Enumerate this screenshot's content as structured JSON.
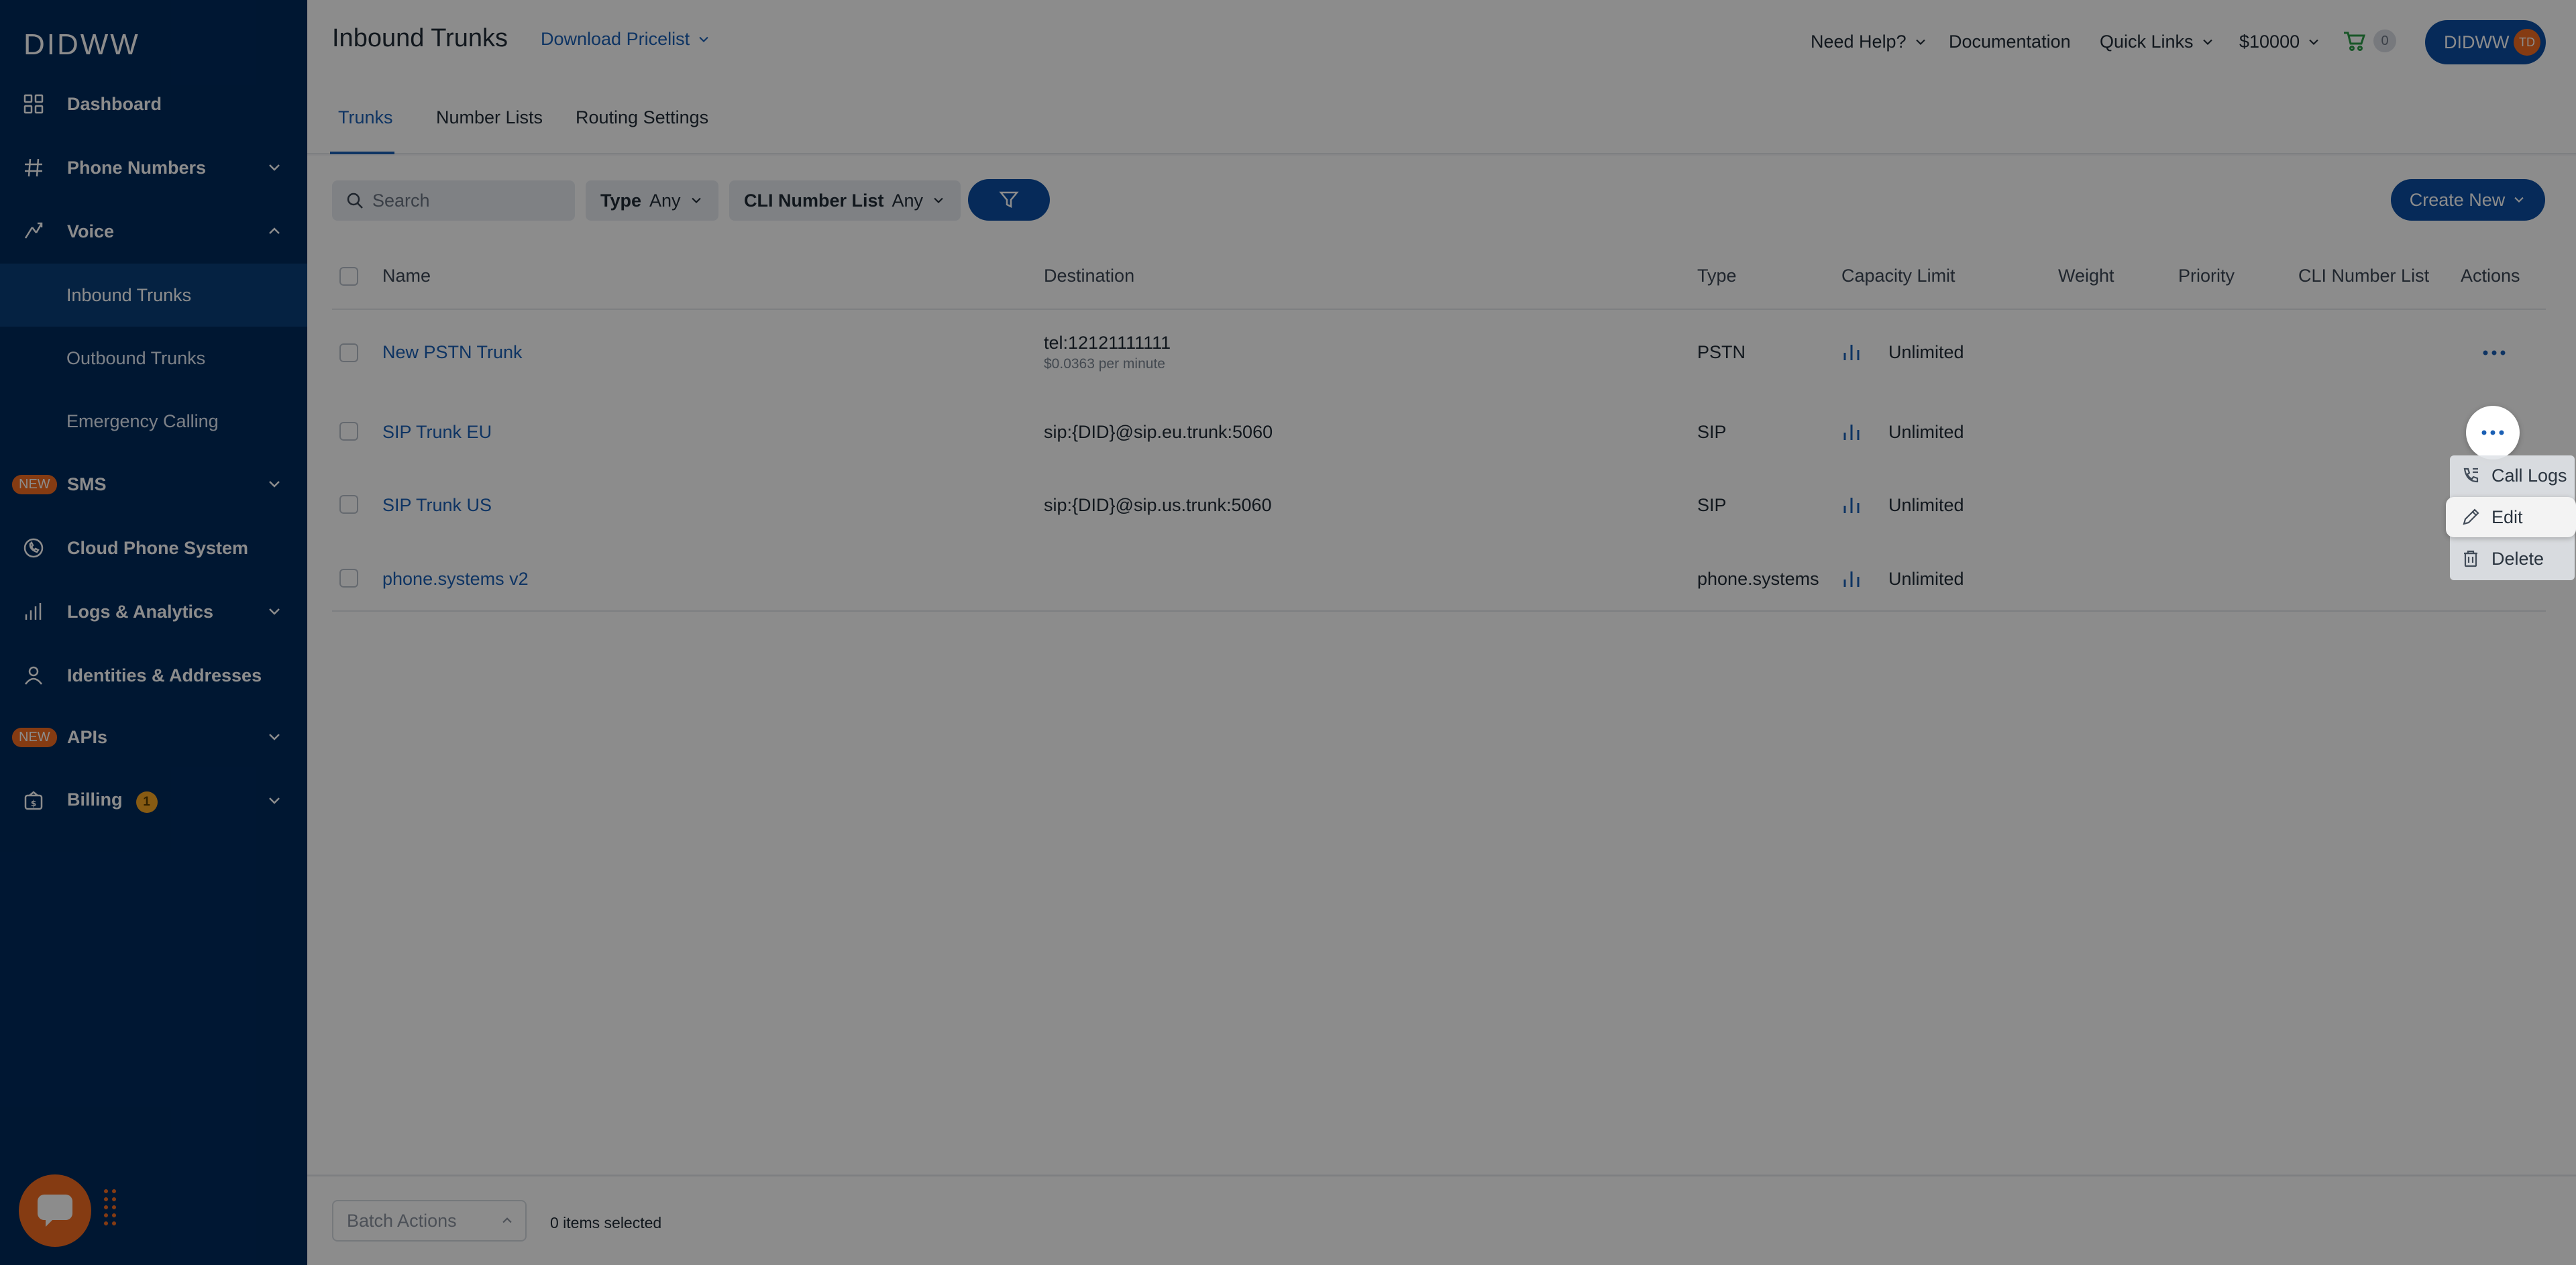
{
  "brand": {
    "logo_text": "DIDWW",
    "accent": "#0b4ea2",
    "sidebar_bg": "#002a5c",
    "orange": "#f36c21"
  },
  "sidebar": {
    "items": [
      {
        "label": "Dashboard",
        "icon": "grid-icon"
      },
      {
        "label": "Phone Numbers",
        "icon": "hash-icon"
      },
      {
        "label": "Voice",
        "icon": "voice-icon"
      },
      {
        "label": "SMS",
        "icon": "new-badge",
        "badge": "NEW"
      },
      {
        "label": "Cloud Phone System",
        "icon": "phone-icon"
      },
      {
        "label": "Logs & Analytics",
        "icon": "bar-chart-icon"
      },
      {
        "label": "Identities & Addresses",
        "icon": "person-icon"
      },
      {
        "label": "APIs",
        "icon": "new-badge",
        "badge": "NEW"
      },
      {
        "label": "Billing",
        "icon": "wallet-icon",
        "badge_count": "1"
      }
    ],
    "voice_sub": [
      "Inbound Trunks",
      "Outbound Trunks",
      "Emergency Calling"
    ]
  },
  "header": {
    "title": "Inbound Trunks",
    "pricelist": "Download Pricelist",
    "need_help": "Need Help?",
    "documentation": "Documentation",
    "quick_links": "Quick Links",
    "balance": "$10000",
    "cart_count": "0",
    "account": "DIDWW",
    "avatar_initials": "TD"
  },
  "tabs": [
    "Trunks",
    "Number Lists",
    "Routing Settings"
  ],
  "filters": {
    "search_placeholder": "Search",
    "type_label": "Type",
    "type_value": "Any",
    "cli_label": "CLI Number List",
    "cli_value": "Any",
    "create_new": "Create New"
  },
  "table": {
    "columns": [
      "Name",
      "Destination",
      "Type",
      "Capacity Limit",
      "Weight",
      "Priority",
      "CLI Number List",
      "Actions"
    ],
    "rows": [
      {
        "name": "New PSTN Trunk",
        "destination": "tel:12121111111",
        "destination_sub": "$0.0363 per minute",
        "type": "PSTN",
        "capacity": "Unlimited"
      },
      {
        "name": "SIP Trunk EU",
        "destination": "sip:{DID}@sip.eu.trunk:5060",
        "destination_sub": "",
        "type": "SIP",
        "capacity": "Unlimited"
      },
      {
        "name": "SIP Trunk US",
        "destination": "sip:{DID}@sip.us.trunk:5060",
        "destination_sub": "",
        "type": "SIP",
        "capacity": "Unlimited"
      },
      {
        "name": "phone.systems v2",
        "destination": "",
        "destination_sub": "",
        "type": "phone.systems",
        "capacity": "Unlimited"
      }
    ]
  },
  "footer": {
    "batch_actions": "Batch Actions",
    "selected": "0 items selected"
  },
  "action_menu": [
    "Call Logs",
    "Edit",
    "Delete"
  ]
}
